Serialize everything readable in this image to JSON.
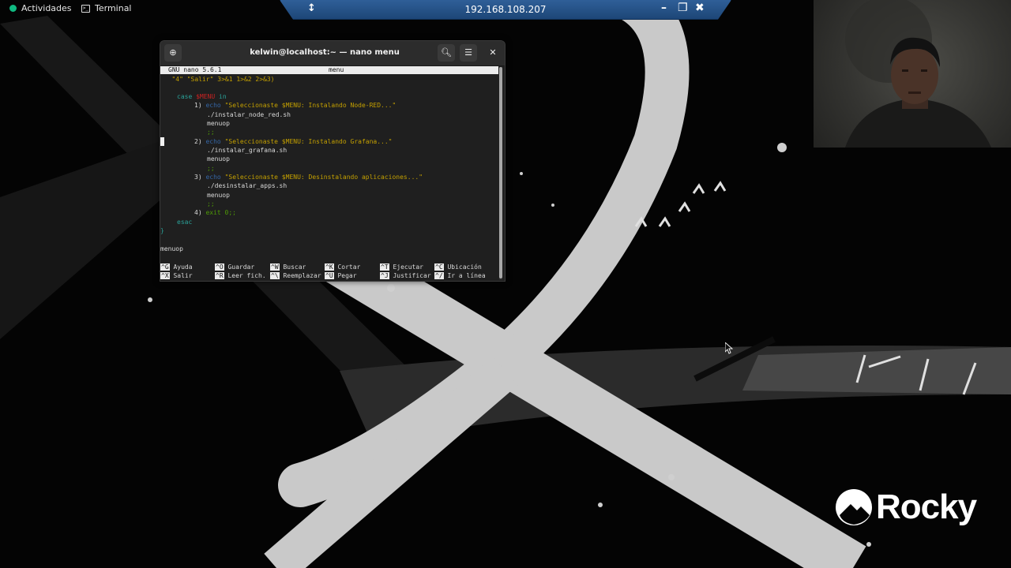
{
  "topbar": {
    "activities_label": "Actividades",
    "app_label": "Terminal"
  },
  "remote_session": {
    "host": "192.168.108.207",
    "icons": [
      "pin-icon",
      "minimize-icon",
      "restore-icon",
      "close-icon"
    ]
  },
  "terminal": {
    "title": "kelwin@localhost:~ — nano menu",
    "icons": [
      "new-tab-icon",
      "search-icon",
      "hamburger-menu-icon",
      "close-icon"
    ],
    "nano": {
      "version": "GNU nano 5.6.1",
      "filename": "menu",
      "code": {
        "l1_indent": "   ",
        "l1_text": "\"4\" \"Salir\" 3>&1 1>&2 2>&3)",
        "l3_case": "case",
        "l3_var": "$MENU",
        "l3_in": "in",
        "opt1_num": "1)",
        "opt1_echo": "echo",
        "opt1_str": "\"Seleccionaste $MENU: Instalando Node-RED...\"",
        "opt1_cmd": "./instalar_node_red.sh",
        "menuop": "menuop",
        "semi": ";;",
        "opt2_num": "2)",
        "opt2_echo": "echo",
        "opt2_str": "\"Seleccionaste $MENU: Instalando Grafana...\"",
        "opt2_cmd": "./instalar_grafana.sh",
        "opt3_num": "3)",
        "opt3_echo": "echo",
        "opt3_str": "\"Seleccionaste $MENU: Desinstalando aplicaciones...\"",
        "opt3_cmd": "./desinstalar_apps.sh",
        "opt4_num": "4)",
        "opt4_exit": "exit 0;;",
        "esac": "esac",
        "brace": "}",
        "final_call": "menuop"
      },
      "shortcuts": [
        {
          "key": "^G",
          "label": "Ayuda"
        },
        {
          "key": "^O",
          "label": "Guardar"
        },
        {
          "key": "^W",
          "label": "Buscar"
        },
        {
          "key": "^K",
          "label": "Cortar"
        },
        {
          "key": "^T",
          "label": "Ejecutar"
        },
        {
          "key": "^C",
          "label": "Ubicación"
        },
        {
          "key": "^X",
          "label": "Salir"
        },
        {
          "key": "^R",
          "label": "Leer fich."
        },
        {
          "key": "^\\",
          "label": "Reemplazar"
        },
        {
          "key": "^U",
          "label": "Pegar"
        },
        {
          "key": "^J",
          "label": "Justificar"
        },
        {
          "key": "^/",
          "label": "Ir a línea"
        }
      ]
    }
  },
  "branding": {
    "logo_text": "Rocky"
  },
  "colors": {
    "topbar_text": "#e6e6e6",
    "rdp_bar": "#2f5f98",
    "terminal_bg": "#1f1f1f",
    "terminal_header": "#2c2c2c",
    "nano_header_bg": "#ececec",
    "keyword_cyan": "#2aa198",
    "string_yellow": "#c4a000",
    "echo_blue": "#3465a4",
    "var_red": "#cc2222",
    "rocky_green": "#10b981"
  }
}
